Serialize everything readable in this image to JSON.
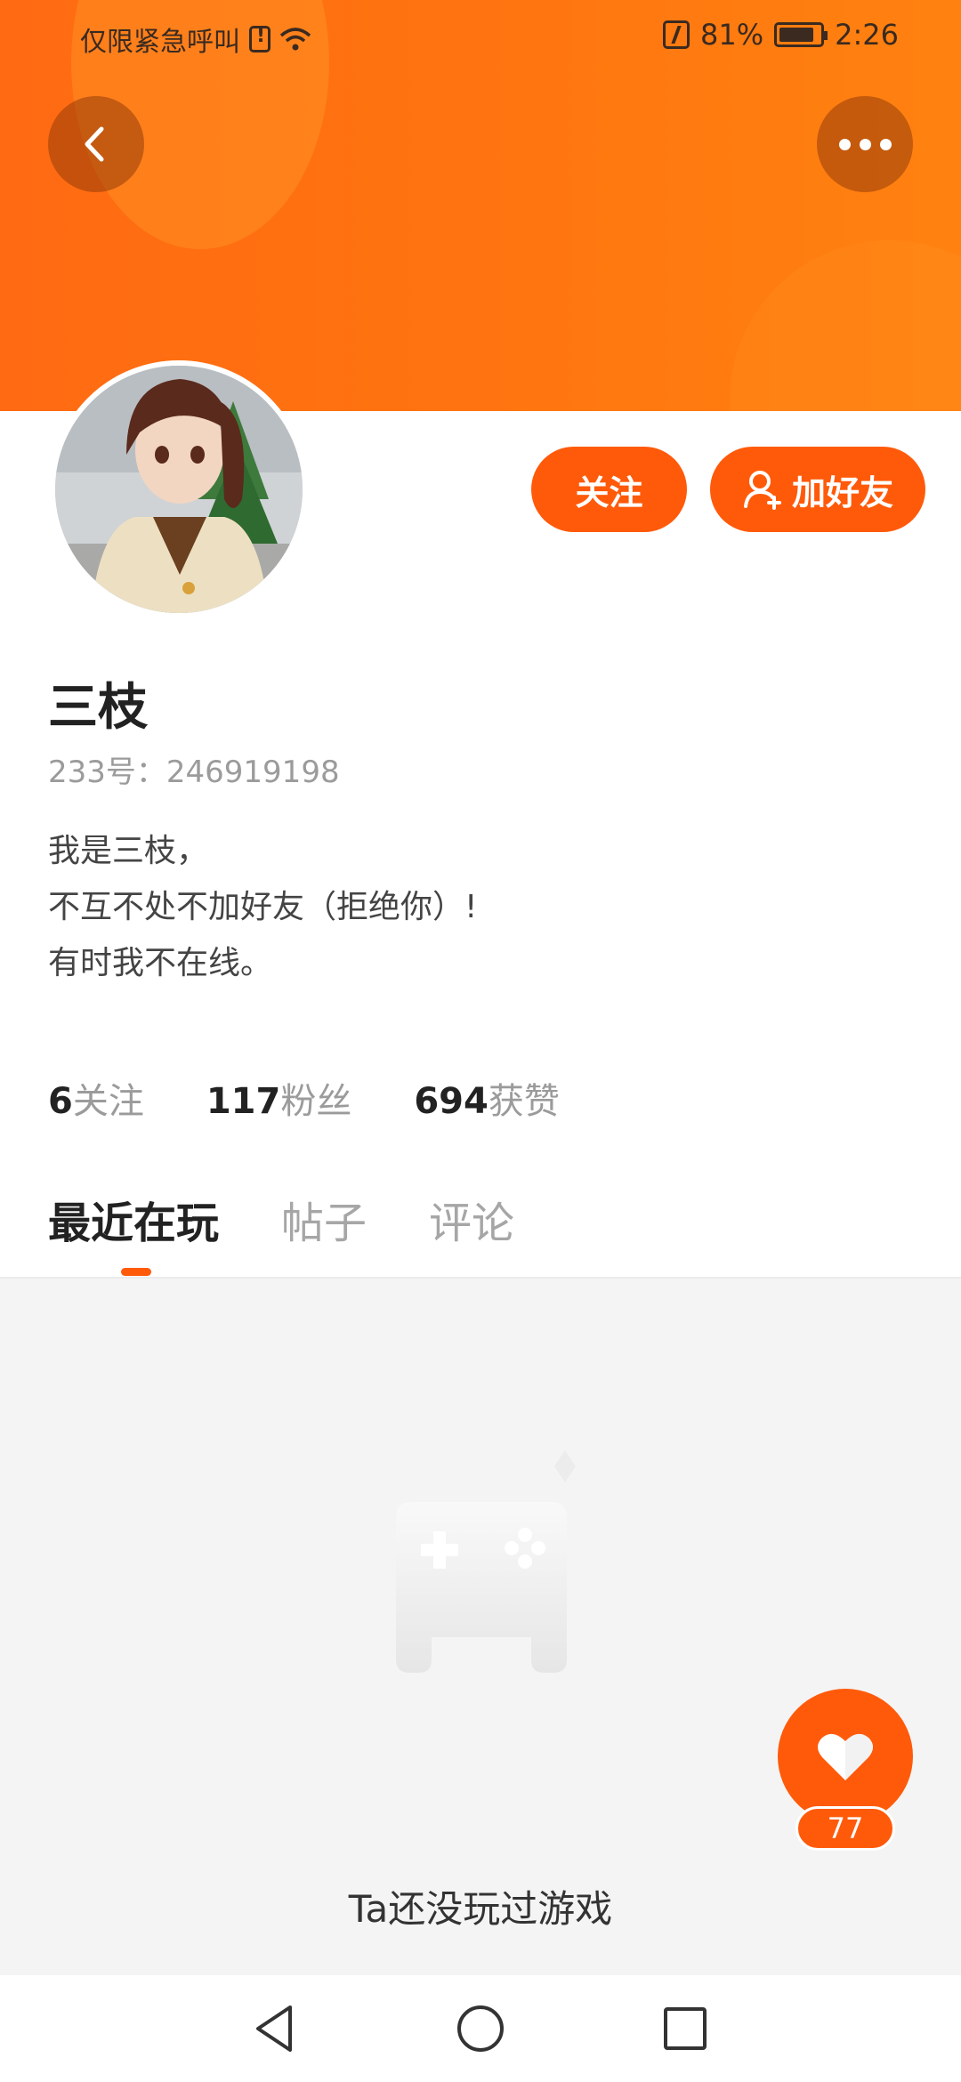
{
  "status_bar": {
    "carrier_text": "仅限紧急呼叫",
    "battery": "81%",
    "time": "2:26"
  },
  "header": {
    "back_icon": "chevron-left-icon",
    "more_icon": "more-dots-icon"
  },
  "profile": {
    "name": "三枝",
    "uid": "233号：246919198",
    "bio": [
      "我是三枝，",
      "不互不处不加好友（拒绝你）!",
      "有时我不在线。"
    ],
    "follow_label": "关注",
    "add_friend_label": "加好友"
  },
  "stats": [
    {
      "num": "6",
      "label": "关注"
    },
    {
      "num": "117",
      "label": "粉丝"
    },
    {
      "num": "694",
      "label": "获赞"
    }
  ],
  "tabs": [
    {
      "label": "最近在玩",
      "active": true
    },
    {
      "label": "帖子",
      "active": false
    },
    {
      "label": "评论",
      "active": false
    }
  ],
  "empty_state": {
    "message": "Ta还没玩过游戏",
    "icon": "gamepad-icon"
  },
  "like": {
    "count": "77",
    "icon": "heart-icon"
  },
  "colors": {
    "accent": "#ff5a0a",
    "banner": "#ff7410"
  }
}
